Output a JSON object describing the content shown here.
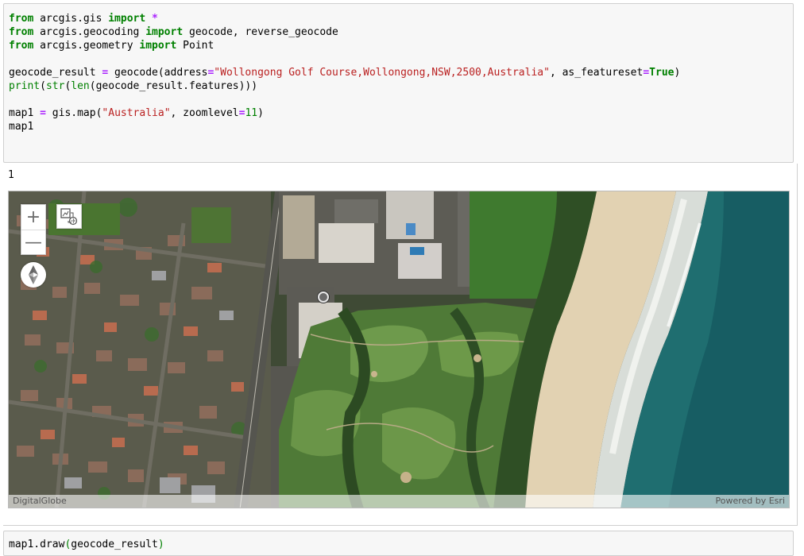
{
  "cell1": {
    "lines": [
      [
        {
          "t": "from",
          "c": "kw"
        },
        {
          "t": " arcgis.gis "
        },
        {
          "t": "import",
          "c": "kw"
        },
        {
          "t": " "
        },
        {
          "t": "*",
          "c": "op"
        }
      ],
      [
        {
          "t": "from",
          "c": "kw"
        },
        {
          "t": " arcgis.geocoding "
        },
        {
          "t": "import",
          "c": "kw"
        },
        {
          "t": " geocode, reverse_geocode"
        }
      ],
      [
        {
          "t": "from",
          "c": "kw"
        },
        {
          "t": " arcgis.geometry "
        },
        {
          "t": "import",
          "c": "kw"
        },
        {
          "t": " Point"
        }
      ],
      [],
      [
        {
          "t": "geocode_result "
        },
        {
          "t": "=",
          "c": "op"
        },
        {
          "t": " geocode(address"
        },
        {
          "t": "=",
          "c": "op"
        },
        {
          "t": "\"Wollongong Golf Course,Wollongong,NSW,2500,Australia\"",
          "c": "str"
        },
        {
          "t": ", as_featureset"
        },
        {
          "t": "=",
          "c": "op"
        },
        {
          "t": "True",
          "c": "kw"
        },
        {
          "t": ")"
        }
      ],
      [
        {
          "t": "print",
          "c": "bi"
        },
        {
          "t": "("
        },
        {
          "t": "str",
          "c": "bi"
        },
        {
          "t": "("
        },
        {
          "t": "len",
          "c": "bi"
        },
        {
          "t": "(geocode_result.features)))"
        }
      ],
      [],
      [
        {
          "t": "map1 "
        },
        {
          "t": "=",
          "c": "op"
        },
        {
          "t": " gis.map("
        },
        {
          "t": "\"Australia\"",
          "c": "str"
        },
        {
          "t": ", zoomlevel"
        },
        {
          "t": "=",
          "c": "op"
        },
        {
          "t": "11",
          "c": "num"
        },
        {
          "t": ")"
        }
      ],
      [
        {
          "t": "map1"
        }
      ]
    ]
  },
  "output": {
    "text": "1"
  },
  "map": {
    "attribution_left": "DigitalGlobe",
    "attribution_right": "Powered by Esri",
    "zoom_in_label": "+",
    "zoom_out_label": "—",
    "icons": {
      "zoom_in": "plus-icon",
      "zoom_out": "minus-icon",
      "mode": "2d-3d-switch-icon",
      "compass": "compass-icon",
      "marker": "location-marker-icon"
    }
  },
  "cell2": {
    "lines": [
      [
        {
          "t": "map1.draw"
        },
        {
          "t": "(",
          "c": "bi"
        },
        {
          "t": "geocode_result"
        },
        {
          "t": ")",
          "c": "bi"
        }
      ]
    ]
  },
  "colors": {
    "keyword": "#008000",
    "operator": "#aa22ff",
    "string": "#ba2121",
    "cell_bg": "#f7f7f7",
    "cell_border": "#cfcfcf"
  }
}
